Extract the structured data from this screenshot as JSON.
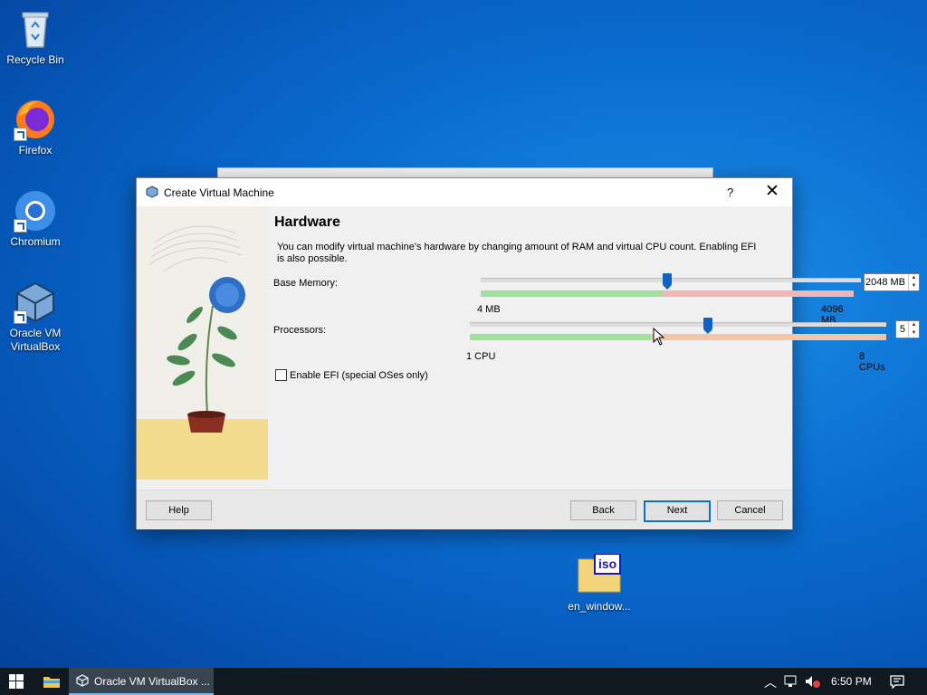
{
  "desktop": {
    "icons": [
      {
        "label": "Recycle Bin",
        "icon": "recycle-bin-icon"
      },
      {
        "label": "Firefox",
        "icon": "firefox-icon"
      },
      {
        "label": "Chromium",
        "icon": "chromium-icon"
      },
      {
        "label": "Oracle VM\nVirtualBox",
        "icon": "virtualbox-icon"
      }
    ],
    "iso_file": {
      "label": "en_window...",
      "badge": "iso"
    }
  },
  "dialog": {
    "title": "Create Virtual Machine",
    "help_glyph": "?",
    "close_glyph": "✕",
    "heading": "Hardware",
    "description": "You can modify virtual machine's hardware by changing amount of RAM and virtual CPU count. Enabling EFI is also possible.",
    "memory": {
      "label": "Base Memory:",
      "value": "2048 MB",
      "min_label": "4 MB",
      "max_label": "4096 MB",
      "fraction": 0.5
    },
    "processors": {
      "label": "Processors:",
      "value": "5",
      "min_label": "1 CPU",
      "max_label": "8 CPUs",
      "fraction": 0.571
    },
    "efi": {
      "label": "Enable EFI (special OSes only)",
      "checked": false
    },
    "buttons": {
      "help": "Help",
      "back": "Back",
      "next": "Next",
      "cancel": "Cancel"
    }
  },
  "taskbar": {
    "app_label": "Oracle VM VirtualBox ...",
    "time": "6:50 PM"
  },
  "colors": {
    "accent": "#0a6fd6",
    "slider_thumb": "#0f62c4",
    "good_range": "#9ee39a",
    "warn_range": "#f3b5b5",
    "cpu_warn_range": "#f5c5a8"
  }
}
